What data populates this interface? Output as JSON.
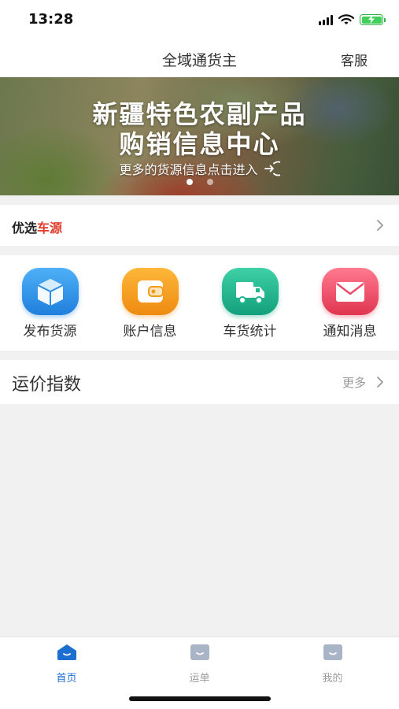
{
  "status_bar": {
    "time": "13:28"
  },
  "nav": {
    "title": "全域通货主",
    "service": "客服"
  },
  "banner": {
    "title_line1": "新疆特色农副产品",
    "title_line2": "购销信息中心",
    "subtitle": "更多的货源信息点击进入",
    "slide_count": 2,
    "active_slide": 1
  },
  "featured": {
    "label_part1": "优选",
    "label_part2": "车源",
    "accent_color": "#e43b2d"
  },
  "quick_actions": [
    {
      "label": "发布货源",
      "icon": "cube-icon",
      "color": "#2a8fe6"
    },
    {
      "label": "账户信息",
      "icon": "wallet-icon",
      "color": "#f29a1a"
    },
    {
      "label": "车货统计",
      "icon": "truck-icon",
      "color": "#1fb58f"
    },
    {
      "label": "通知消息",
      "icon": "mail-icon",
      "color": "#ec4a68"
    }
  ],
  "freight_index": {
    "title": "运价指数",
    "more": "更多"
  },
  "tabs": [
    {
      "label": "首页",
      "icon": "home-tab-icon",
      "active": true
    },
    {
      "label": "运单",
      "icon": "waybill-tab-icon",
      "active": false
    },
    {
      "label": "我的",
      "icon": "profile-tab-icon",
      "active": false
    }
  ],
  "colors": {
    "active_tab": "#1c6fd1",
    "inactive_tab": "#9a9a9a"
  }
}
